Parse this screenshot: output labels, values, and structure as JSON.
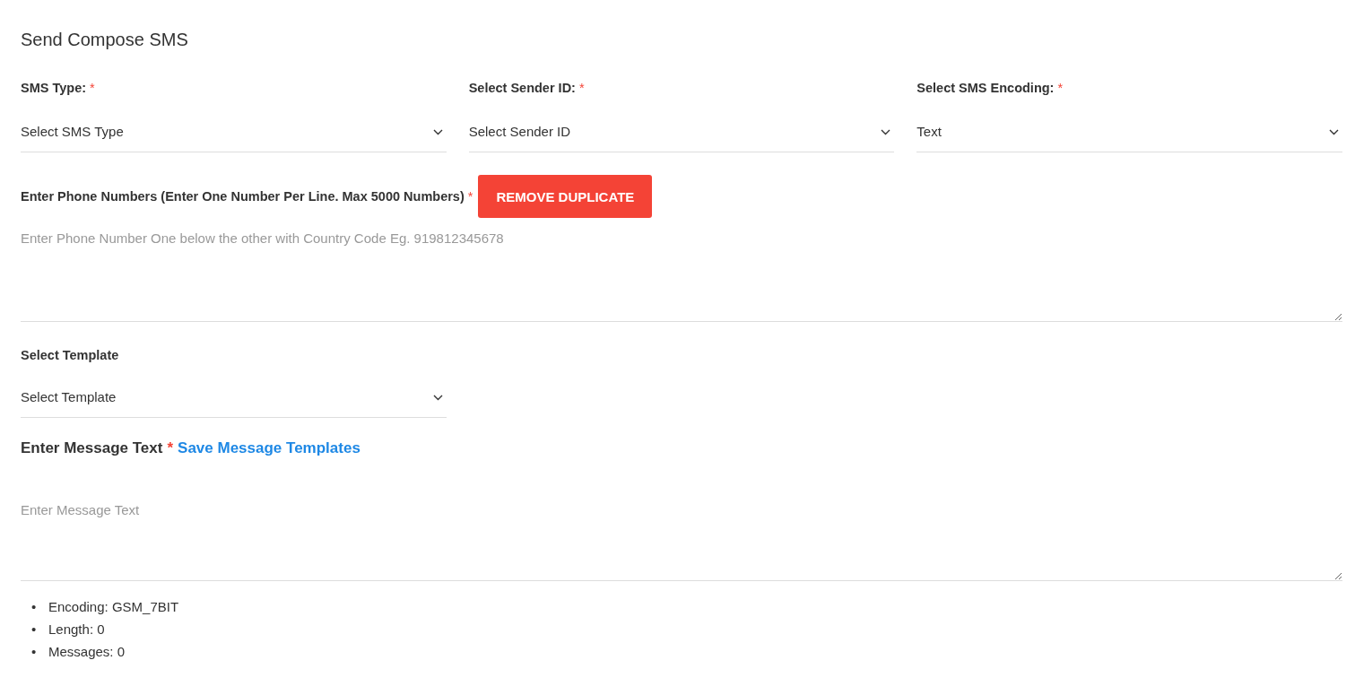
{
  "title": "Send Compose SMS",
  "selects": [
    {
      "label": "SMS Type:",
      "mark": "*",
      "value": "Select SMS Type"
    },
    {
      "label": "Select Sender ID:",
      "mark": "*",
      "value": "Select Sender ID"
    },
    {
      "label": "Select SMS Encoding:",
      "mark": "*",
      "value": "Text"
    }
  ],
  "phone": {
    "label": "Enter Phone Numbers (Enter One Number Per Line. Max 5000 Numbers)",
    "mark": "*",
    "button": "REMOVE DUPLICATE",
    "placeholder": "Enter Phone Number One below the other with Country Code Eg. 919812345678"
  },
  "template": {
    "label": "Select Template",
    "value": "Select Template"
  },
  "message": {
    "label": "Enter Message Text",
    "mark": "*",
    "link": "Save Message Templates",
    "placeholder": "Enter Message Text"
  },
  "stats": [
    {
      "bullet": "•",
      "text": "Encoding: GSM_7BIT"
    },
    {
      "bullet": "•",
      "text": "Length: 0"
    },
    {
      "bullet": "•",
      "text": "Messages: 0"
    }
  ]
}
